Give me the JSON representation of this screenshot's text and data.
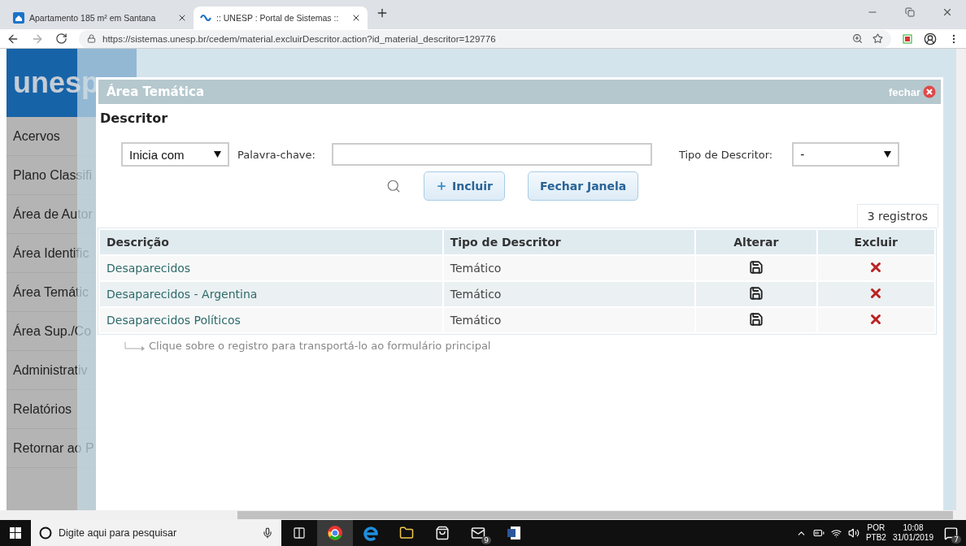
{
  "browser": {
    "tabs": [
      {
        "title": "Apartamento 185 m² em Santana",
        "selected": false
      },
      {
        "title": ":: UNESP : Portal de Sistemas ::",
        "selected": true
      }
    ],
    "url": "https://sistemas.unesp.br/cedem/material.excluirDescritor.action?id_material_descritor=129776"
  },
  "sidebar": {
    "logo": "unesp",
    "items": [
      "Acervos",
      "Plano Classifi",
      "Área de Autor",
      "Área Identific",
      "Área Temátic",
      "Área Sup./Co",
      "Administrativ",
      "Relatórios",
      "Retornar ao P"
    ]
  },
  "modal": {
    "title": "Área Temática",
    "close_label": "fechar",
    "section_title": "Descritor",
    "match_mode": "Inicia com",
    "keyword_label": "Palavra-chave:",
    "type_label": "Tipo de Descritor:",
    "type_value": "-",
    "buttons": [
      {
        "label": "Incluir",
        "kind": "add"
      },
      {
        "label": "Fechar Janela",
        "kind": "plain"
      }
    ],
    "record_count": "3 registros",
    "table": {
      "columns": [
        "Descrição",
        "Tipo de Descritor",
        "Alterar",
        "Excluir"
      ],
      "rows": [
        {
          "description": "Desaparecidos",
          "type": "Temático"
        },
        {
          "description": "Desaparecidos - Argentina",
          "type": "Temático"
        },
        {
          "description": "Desaparecidos Políticos",
          "type": "Temático"
        }
      ]
    },
    "hint": "Clique sobre o registro para transportá-lo ao formulário principal"
  },
  "taskbar": {
    "search_placeholder": "Digite aqui para pesquisar",
    "mail_badge": "9",
    "language": "POR",
    "layout": "PTB2",
    "time": "10:08",
    "date": "31/01/2019",
    "notifications": "7"
  }
}
